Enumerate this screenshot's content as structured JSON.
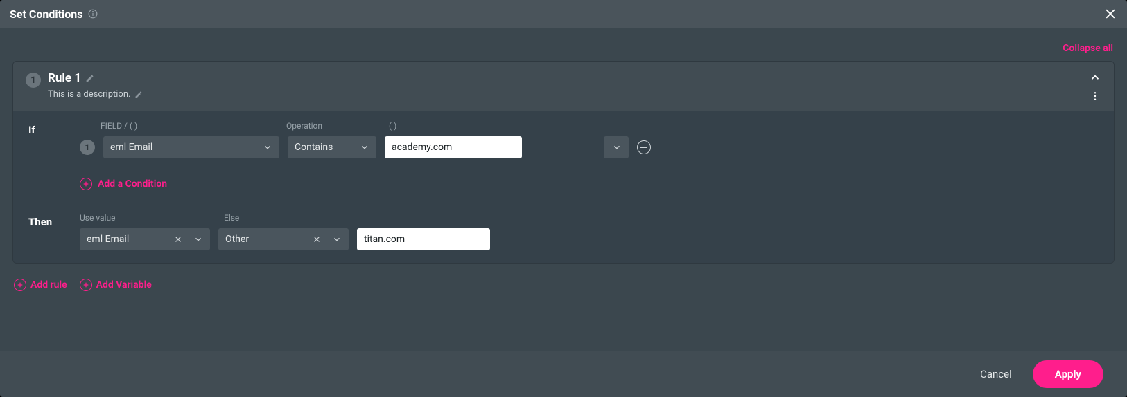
{
  "modal": {
    "title": "Set Conditions",
    "collapse_all": "Collapse all"
  },
  "rule": {
    "index": "1",
    "title": "Rule 1",
    "description": "This is a description."
  },
  "section": {
    "if_label": "If",
    "then_label": "Then",
    "headers": {
      "field": "FIELD / ( )",
      "operation": "Operation",
      "paren": "( )",
      "use_value": "Use value",
      "else": "Else"
    }
  },
  "condition": {
    "row_index": "1",
    "field": "eml Email",
    "operation": "Contains",
    "value": "academy.com"
  },
  "then": {
    "use_value": "eml Email",
    "else_select": "Other",
    "else_value": "titan.com"
  },
  "actions": {
    "add_condition": "Add a Condition",
    "add_rule": "Add rule",
    "add_variable": "Add Variable"
  },
  "footer": {
    "cancel": "Cancel",
    "apply": "Apply"
  }
}
